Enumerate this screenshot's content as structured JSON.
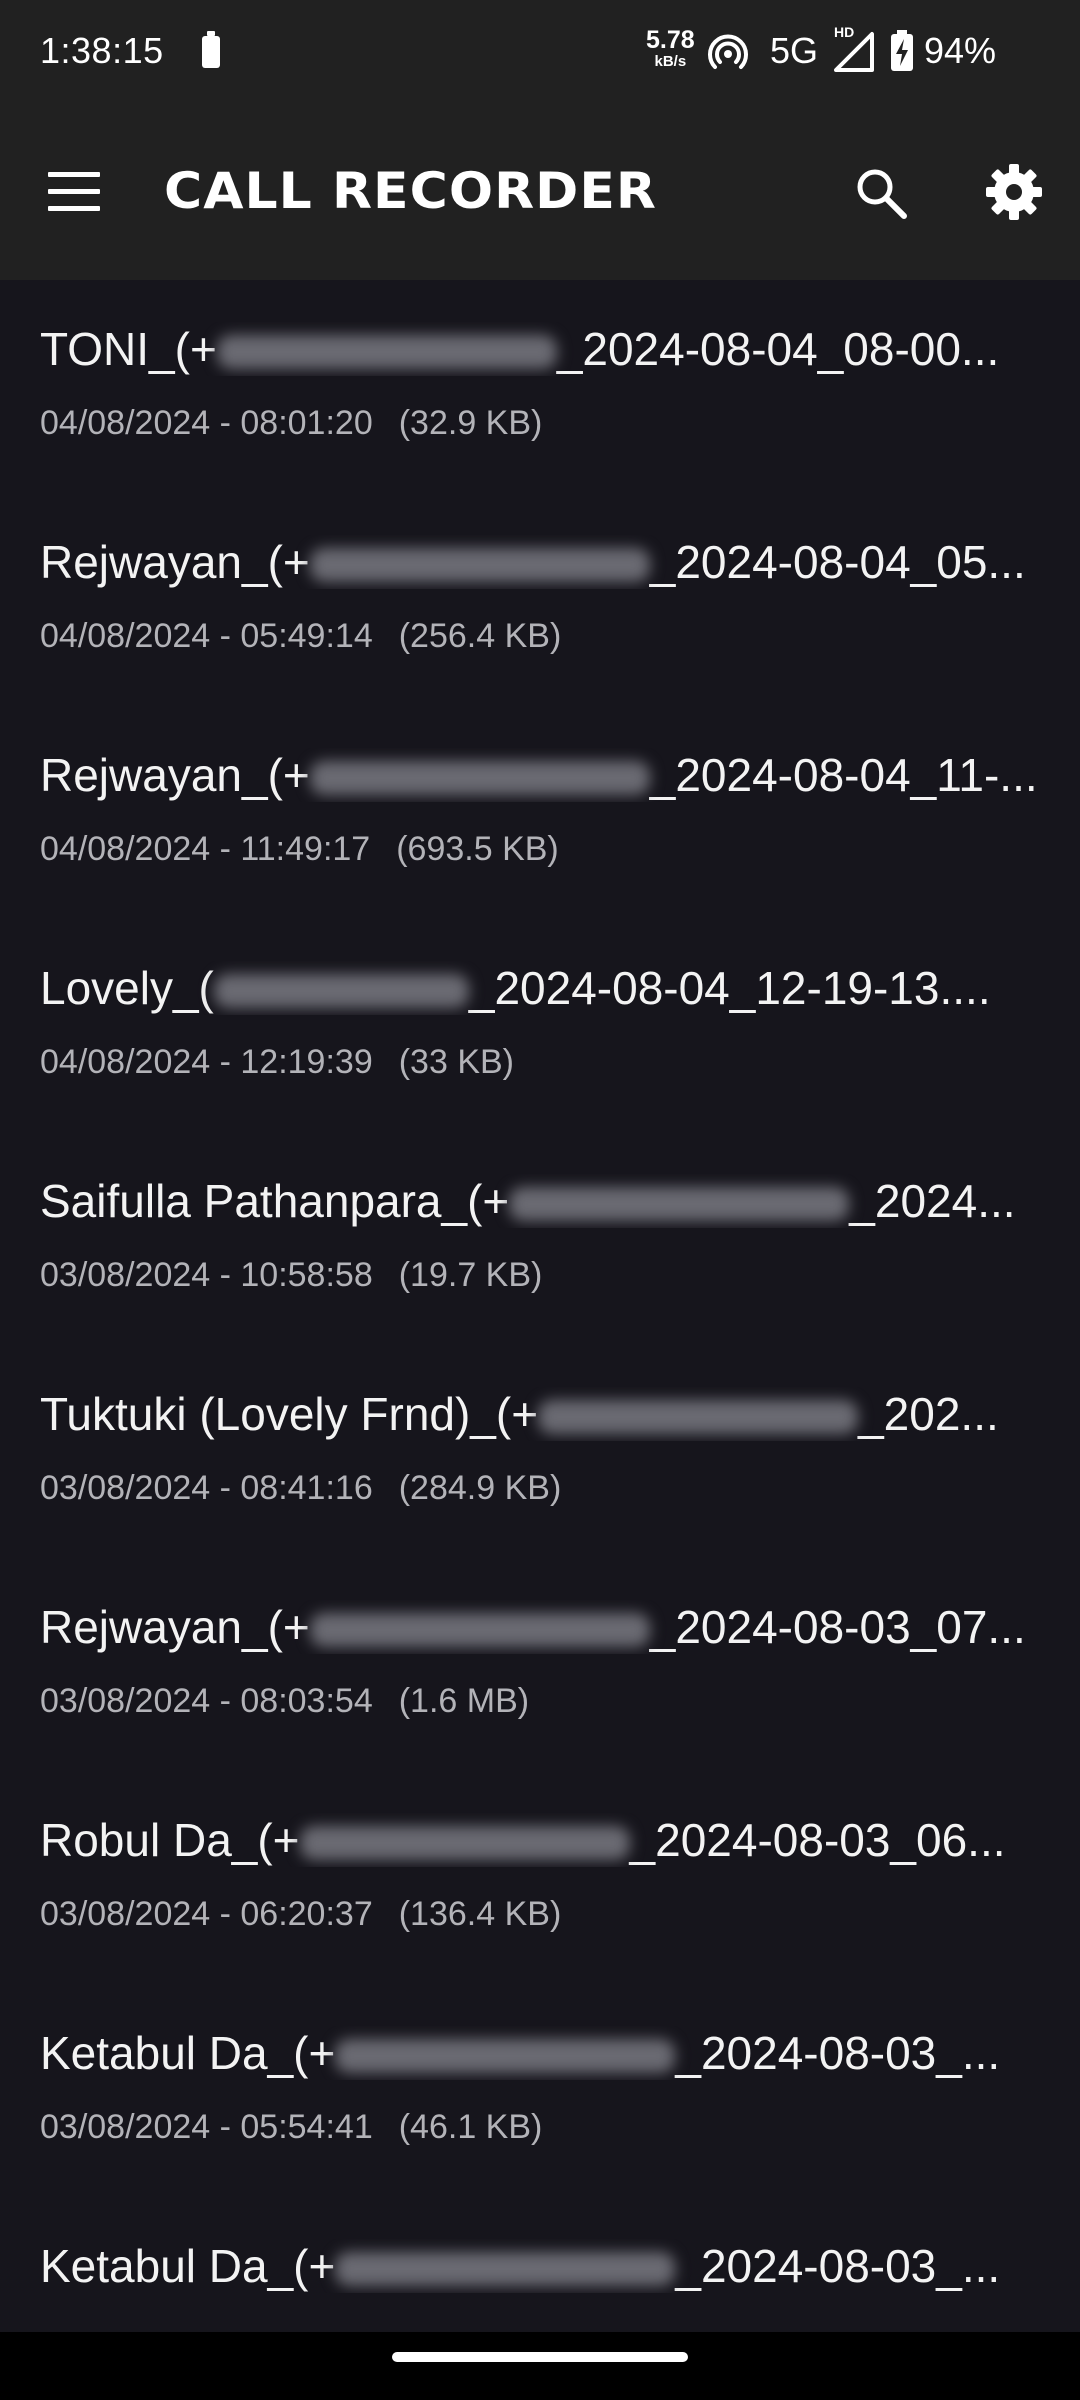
{
  "status_bar": {
    "time": "1:38:15",
    "net_speed_value": "5.78",
    "net_speed_unit": "kB/s",
    "network_type": "5G",
    "hd_label": "HD",
    "battery_percent": "94%",
    "icons": [
      "battery-icon",
      "hotspot-icon",
      "signal-icon",
      "battery-charging-icon"
    ]
  },
  "app_bar": {
    "title": "CALL RECORDER",
    "icons": [
      "menu-icon",
      "search-icon",
      "gear-icon"
    ]
  },
  "recordings": [
    {
      "name": "TONI_(+",
      "suffix": "_2024-08-04_08-00...",
      "date": "04/08/2024 - 08:01:20",
      "size": "(32.9 KB)"
    },
    {
      "name": "Rejwayan_(+",
      "suffix": "_2024-08-04_05...",
      "date": "04/08/2024 - 05:49:14",
      "size": "(256.4 KB)"
    },
    {
      "name": "Rejwayan_(+",
      "suffix": "_2024-08-04_11-...",
      "date": "04/08/2024 - 11:49:17",
      "size": "(693.5 KB)"
    },
    {
      "name": "Lovely_(",
      "suffix": "_2024-08-04_12-19-13....",
      "date": "04/08/2024 - 12:19:39",
      "size": "(33 KB)"
    },
    {
      "name": "Saifulla Pathanpara_(+",
      "suffix": "_2024...",
      "date": "03/08/2024 - 10:58:58",
      "size": "(19.7 KB)"
    },
    {
      "name": "Tuktuki (Lovely Frnd)_(+",
      "suffix": "_202...",
      "date": "03/08/2024 - 08:41:16",
      "size": "(284.9 KB)"
    },
    {
      "name": "Rejwayan_(+",
      "suffix": "_2024-08-03_07...",
      "date": "03/08/2024 - 08:03:54",
      "size": "(1.6 MB)"
    },
    {
      "name": "Robul Da_(+",
      "suffix": "_2024-08-03_06...",
      "date": "03/08/2024 - 06:20:37",
      "size": "(136.4 KB)"
    },
    {
      "name": "Ketabul Da_(+",
      "suffix": "_2024-08-03_...",
      "date": "03/08/2024 - 05:54:41",
      "size": "(46.1 KB)"
    },
    {
      "name": "Ketabul Da_(+",
      "suffix": "_2024-08-03_...",
      "date": "",
      "size": ""
    }
  ]
}
